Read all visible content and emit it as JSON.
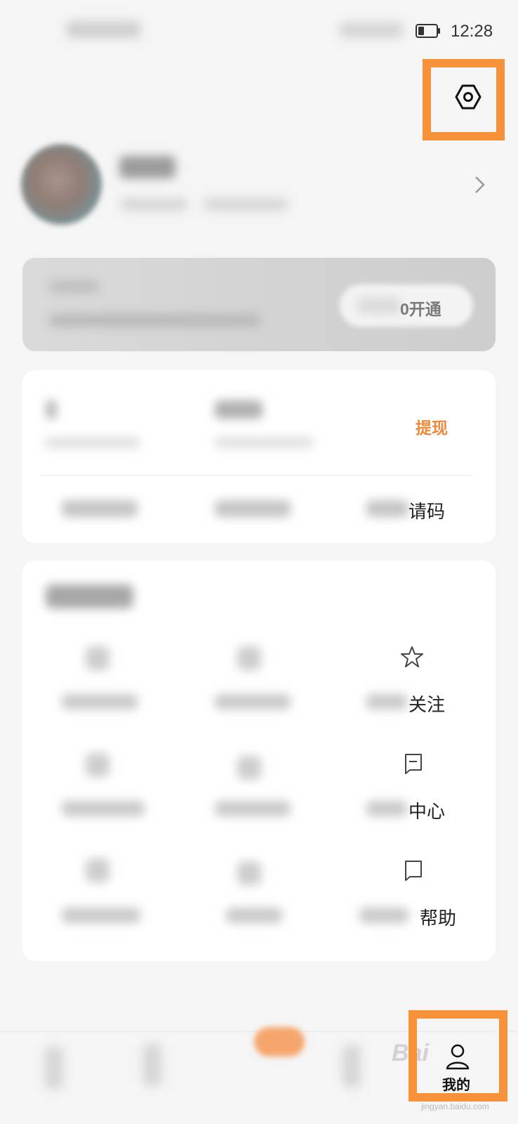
{
  "status_bar": {
    "time": "12:28"
  },
  "vip_banner": {
    "button_label": "0开通"
  },
  "wallet": {
    "withdraw_label": "提现",
    "invite_label": "请码"
  },
  "services": {
    "items": [
      {
        "label": "关注",
        "icon": "star-icon"
      },
      {
        "label": "中心",
        "icon": "message-box-icon"
      },
      {
        "label": "帮助",
        "icon": "help-chat-icon"
      }
    ]
  },
  "bottom_nav": {
    "me_label": "我的",
    "me_icon": "person-icon"
  },
  "watermark": {
    "text": "Bai",
    "subtext": "jingyan.baidu.com"
  },
  "highlight_color": "#f7923a",
  "accent_color": "#ef8a3c"
}
